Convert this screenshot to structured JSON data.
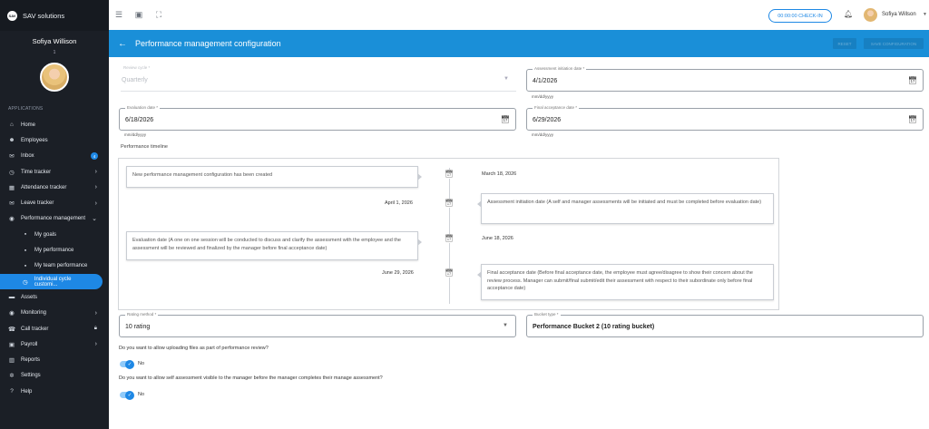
{
  "brand": {
    "logo_text": "SAV",
    "name": "SAV solutions"
  },
  "user": {
    "name": "Sofiya Willison",
    "sub": "1"
  },
  "sidebar": {
    "section_label": "APPLICATIONS",
    "items": [
      {
        "label": "Home",
        "icon": "home-icon",
        "glyph": "⌂"
      },
      {
        "label": "Employees",
        "icon": "people-icon",
        "glyph": "☻"
      },
      {
        "label": "Inbox",
        "icon": "inbox-icon",
        "glyph": "✉",
        "badge": "4"
      },
      {
        "label": "Time tracker",
        "icon": "clock-icon",
        "glyph": "◷"
      },
      {
        "label": "Attendance tracker",
        "icon": "calendar-icon",
        "glyph": "▦"
      },
      {
        "label": "Leave tracker",
        "icon": "mail-icon",
        "glyph": "✉"
      },
      {
        "label": "Performance management",
        "icon": "wifi-icon",
        "glyph": "◉"
      },
      {
        "label": "My goals",
        "icon": "grid-icon",
        "glyph": "▪"
      },
      {
        "label": "My performance",
        "icon": "grid-icon",
        "glyph": "▪"
      },
      {
        "label": "My team performance",
        "icon": "grid-icon",
        "glyph": "▪"
      },
      {
        "label": "Individual cycle customi...",
        "icon": "clock-icon",
        "glyph": "◷"
      },
      {
        "label": "Assets",
        "icon": "monitor-icon",
        "glyph": "▬"
      },
      {
        "label": "Monitoring",
        "icon": "eye-icon",
        "glyph": "◉"
      },
      {
        "label": "Call tracker",
        "icon": "phone-icon",
        "glyph": "☎"
      },
      {
        "label": "Payroll",
        "icon": "wallet-icon",
        "glyph": "▣"
      },
      {
        "label": "Reports",
        "icon": "chart-icon",
        "glyph": "▥"
      },
      {
        "label": "Settings",
        "icon": "gear-icon",
        "glyph": "✲"
      },
      {
        "label": "Help",
        "icon": "help-icon",
        "glyph": "?"
      }
    ]
  },
  "topbar": {
    "checkin_label": "00:00:00 CHECK-IN",
    "user_name": "Sofiya Willson"
  },
  "header": {
    "title": "Performance management configuration",
    "btn_reset": "RESET",
    "btn_save": "SAVE CONFIGURATION"
  },
  "form": {
    "review_cycle": {
      "label": "Review cycle *",
      "value": "Quarterly"
    },
    "assessment_initiation": {
      "label": "Assessment initiation date *",
      "value": "4/1/2026",
      "hint": "mm/dd/yyyy"
    },
    "evaluation": {
      "label": "Evaluation date *",
      "value": "6/18/2026",
      "hint": "mm/dd/yyyy"
    },
    "final_acceptance": {
      "label": "Final acceptance date *",
      "value": "6/29/2026",
      "hint": "mm/dd/yyyy"
    },
    "timeline_title": "Performance timeline",
    "rating_method": {
      "label": "Rating method *",
      "value": "10 rating"
    },
    "bucket_type": {
      "label": "Bucket type *",
      "value": "Performance Bucket 2 (10 rating bucket)"
    }
  },
  "timeline": [
    {
      "side": "left",
      "text": "New performance management configuration has been created",
      "date": "March 18, 2026"
    },
    {
      "side": "right",
      "text": "Assessment initiation date (A self and manager assessments will be initiated and must be completed before evaluation date)",
      "date": "April 1, 2026"
    },
    {
      "side": "left",
      "text": "Evaluation date (A one on one session will be conducted to discuss and clarify the assessment with the employee and the assessment will be reviewed and finalized by the manager before final acceptance date)",
      "date": "June 18, 2026"
    },
    {
      "side": "right",
      "text": "Final acceptance date (Before final acceptance date, the employee must agree/disagree to show their concern about the review process. Manager can submit/final submit/edit their assessment with respect to their subordinate only before final acceptance date)",
      "date": "June 29, 2026"
    }
  ],
  "questions": [
    {
      "text": "Do you want to allow uploading files as part of performance review?",
      "toggle_label": "No"
    },
    {
      "text": "Do you want to allow self assessment visible to the manager before the manager completes their manage assessment?",
      "toggle_label": "No"
    }
  ],
  "colors": {
    "accent": "#1e88e5",
    "sidebar_bg": "#1b1f26",
    "header_bg": "#1a8fd8"
  }
}
